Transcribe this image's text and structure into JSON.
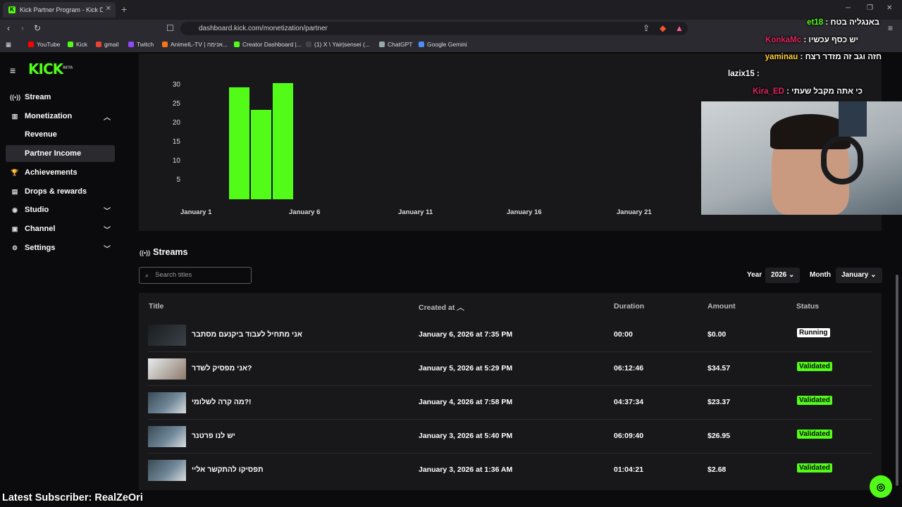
{
  "browser": {
    "tab_title": "Kick Partner Program - Kick Dashboard",
    "url": "dashboard.kick.com/monetization/partner",
    "bookmarks": [
      "YouTube",
      "Kick",
      "gmail",
      "Twitch",
      "AnimeIL-TV | אנימה...",
      "Creator Dashboard |...",
      "(1) X \\ Yair|sensei (...",
      "ChatGPT",
      "Google Gemini"
    ]
  },
  "sidebar": {
    "logo": "KICK",
    "logo_badge": "BETA",
    "items": [
      {
        "label": "Stream",
        "icon": "broadcast-icon"
      },
      {
        "label": "Monetization",
        "icon": "chart-icon"
      },
      {
        "label": "Revenue"
      },
      {
        "label": "Partner Income"
      },
      {
        "label": "Achievements",
        "icon": "trophy-icon"
      },
      {
        "label": "Drops & rewards",
        "icon": "gift-icon"
      },
      {
        "label": "Studio",
        "icon": "studio-icon"
      },
      {
        "label": "Channel",
        "icon": "channel-icon"
      },
      {
        "label": "Settings",
        "icon": "gear-icon"
      }
    ]
  },
  "chart_data": {
    "type": "bar",
    "x": [
      "January 3",
      "January 4",
      "January 5"
    ],
    "values": [
      29.5,
      23.5,
      30.5
    ],
    "y_ticks": [
      "30",
      "25",
      "20",
      "15",
      "10",
      "5"
    ],
    "x_ticks": [
      "January 1",
      "January 6",
      "January 11",
      "January 16",
      "January 21"
    ],
    "ylim": [
      0,
      31
    ],
    "color": "#53fc18"
  },
  "streams": {
    "heading": "Streams",
    "search_placeholder": "Search titles",
    "year_label": "Year",
    "year_value": "2026",
    "month_label": "Month",
    "month_value": "January",
    "columns": [
      "Title",
      "Created at",
      "Duration",
      "Amount",
      "Status"
    ],
    "rows": [
      {
        "title": "אני מתחיל לעבוד ביקנעם מסתבר",
        "created": "January 6, 2026 at 7:35 PM",
        "duration": "00:00",
        "amount": "$0.00",
        "status": "Running"
      },
      {
        "title": "אני מפסיק לשדר?",
        "created": "January 5, 2026 at 5:29 PM",
        "duration": "06:12:46",
        "amount": "$34.57",
        "status": "Validated"
      },
      {
        "title": "מה קרה לשלומי?!",
        "created": "January 4, 2026 at 7:58 PM",
        "duration": "04:37:34",
        "amount": "$23.37",
        "status": "Validated"
      },
      {
        "title": "יש לנו פרטנר",
        "created": "January 3, 2026 at 5:40 PM",
        "duration": "06:09:40",
        "amount": "$26.95",
        "status": "Validated"
      },
      {
        "title": "תפסיקו להתקשר אליי",
        "created": "January 3, 2026 at 1:36 AM",
        "duration": "01:04:21",
        "amount": "$2.68",
        "status": "Validated"
      }
    ]
  },
  "overlay": {
    "chat": [
      {
        "user": "et18",
        "message": "באנגליה בטח"
      },
      {
        "user": "KonkaMc",
        "message": "יש כסף עכשיו"
      },
      {
        "user": "yaminau",
        "message": "חזה וגב זה מזדר רצח"
      },
      {
        "user": "lazix15",
        "message": ""
      },
      {
        "user": "Kira_ED",
        "message": "כי אתה מקבל שעתי"
      }
    ],
    "latest_subscriber": "Latest Subscriber: RealZeOri"
  }
}
